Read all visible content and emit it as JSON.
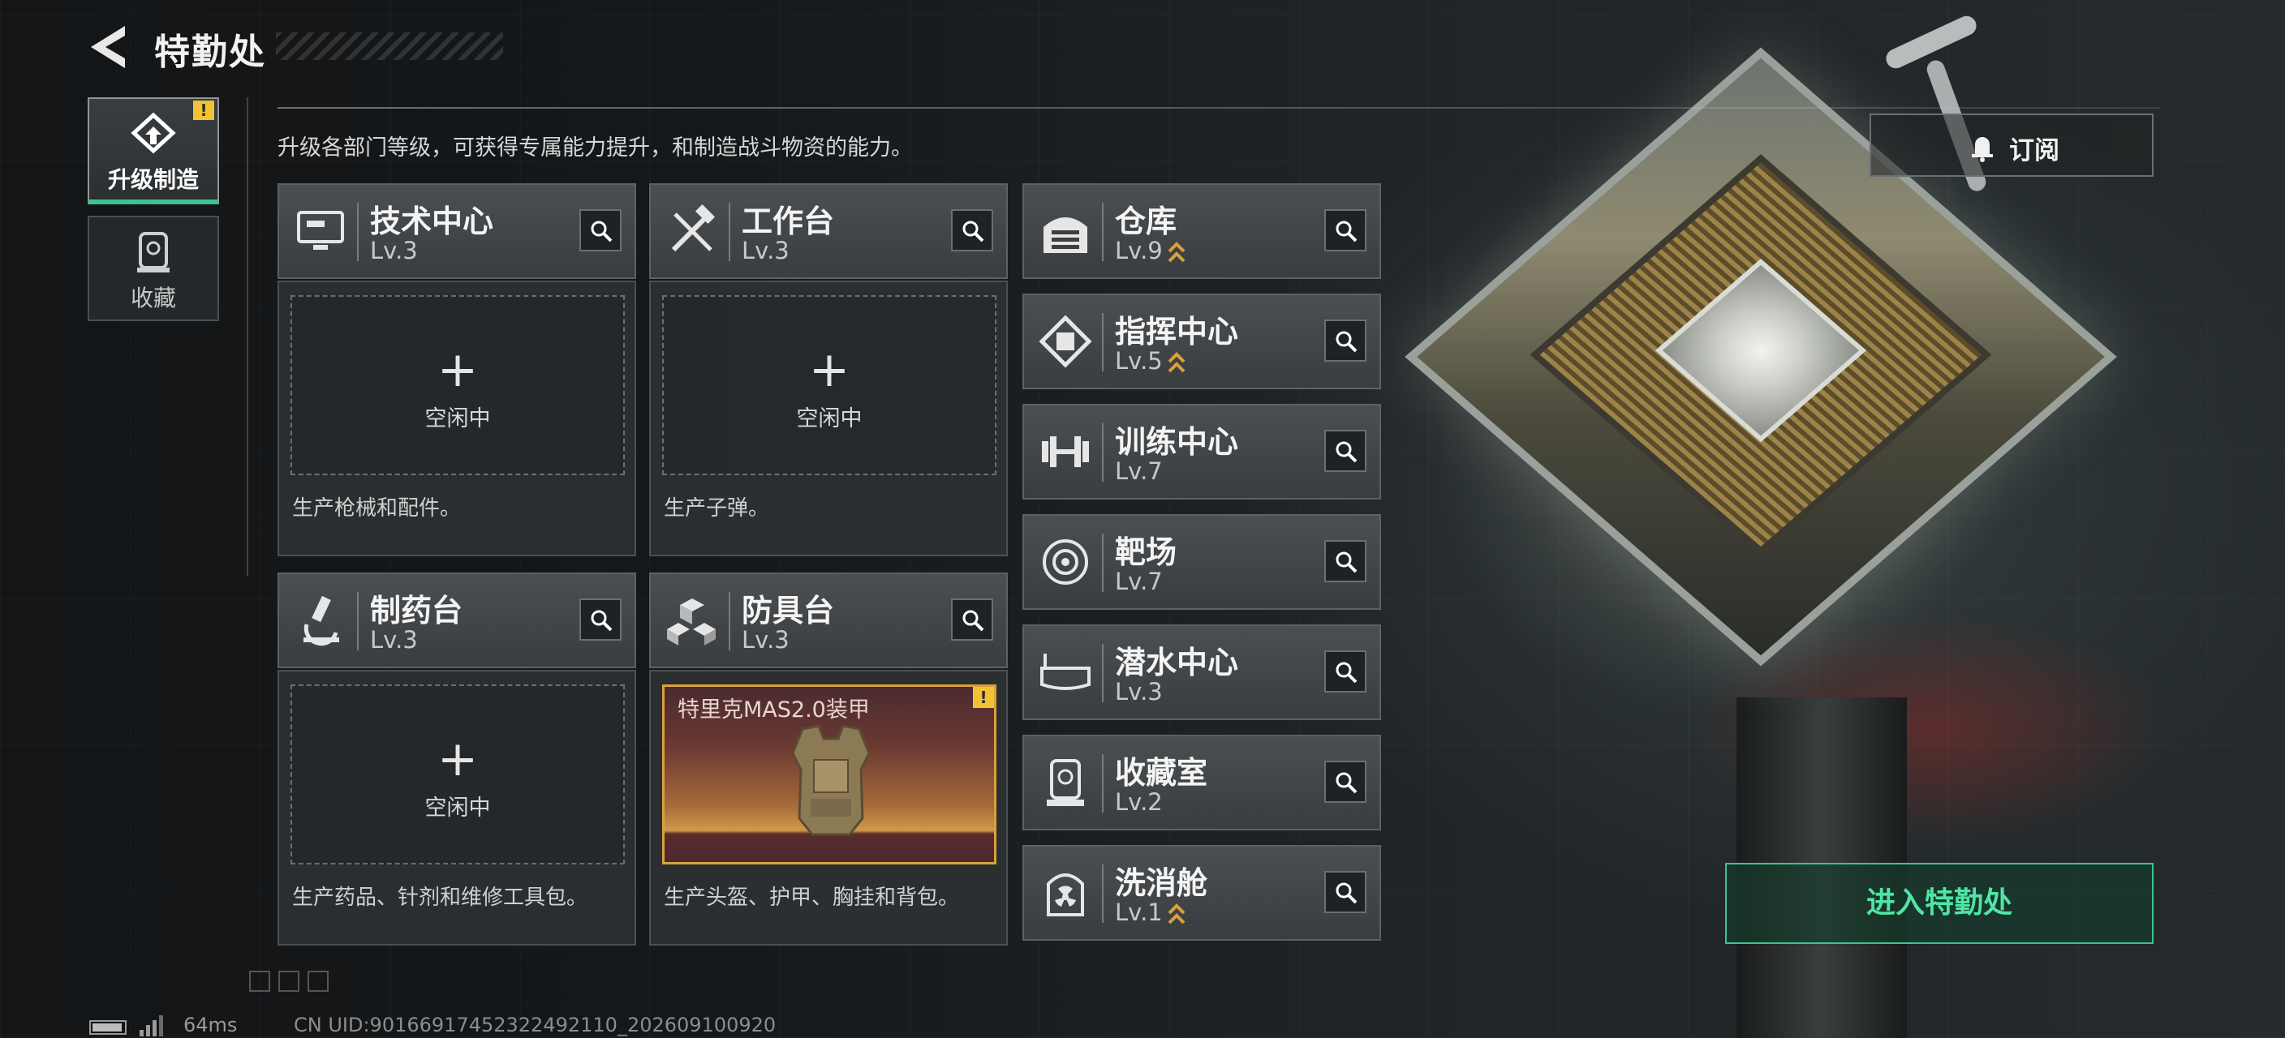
{
  "header": {
    "title": "特勤处"
  },
  "side_tabs": [
    {
      "label": "升级制造",
      "active": true,
      "badge": "!"
    },
    {
      "label": "收藏",
      "active": false
    }
  ],
  "subtitle": "升级各部门等级，可获得专属能力提升，和制造战斗物资的能力。",
  "production_cards": [
    {
      "name": "技术中心",
      "level": "Lv.3",
      "icon": "monitor-icon",
      "slot_state": "空闲中",
      "description": "生产枪械和配件。"
    },
    {
      "name": "工作台",
      "level": "Lv.3",
      "icon": "tools-icon",
      "slot_state": "空闲中",
      "description": "生产子弹。"
    },
    {
      "name": "制药台",
      "level": "Lv.3",
      "icon": "microscope-icon",
      "slot_state": "空闲中",
      "description": "生产药品、针剂和维修工具包。"
    },
    {
      "name": "防具台",
      "level": "Lv.3",
      "icon": "boxes-icon",
      "slot_item": "特里克MAS2.0装甲",
      "slot_badge": "!",
      "description": "生产头盔、护甲、胸挂和背包。"
    }
  ],
  "departments": [
    {
      "name": "仓库",
      "level": "Lv.9",
      "icon": "warehouse-icon",
      "upgradable": true
    },
    {
      "name": "指挥中心",
      "level": "Lv.5",
      "icon": "chip-icon",
      "upgradable": true
    },
    {
      "name": "训练中心",
      "level": "Lv.7",
      "icon": "dumbbell-icon",
      "upgradable": false
    },
    {
      "name": "靶场",
      "level": "Lv.7",
      "icon": "target-icon",
      "upgradable": false
    },
    {
      "name": "潜水中心",
      "level": "Lv.3",
      "icon": "dive-mask-icon",
      "upgradable": false
    },
    {
      "name": "收藏室",
      "level": "Lv.2",
      "icon": "collection-icon",
      "upgradable": false
    },
    {
      "name": "洗消舱",
      "level": "Lv.1",
      "icon": "radiation-icon",
      "upgradable": true
    }
  ],
  "buttons": {
    "subscribe": "订阅",
    "enter": "进入特勤处"
  },
  "footer": {
    "ping": "64ms",
    "uid": "CN UID:901669174523224921​10_202609100920"
  },
  "colors": {
    "accent_green": "#3ec28f",
    "badge_yellow": "#f2c233",
    "upgrade_gold": "#d9a13a"
  }
}
